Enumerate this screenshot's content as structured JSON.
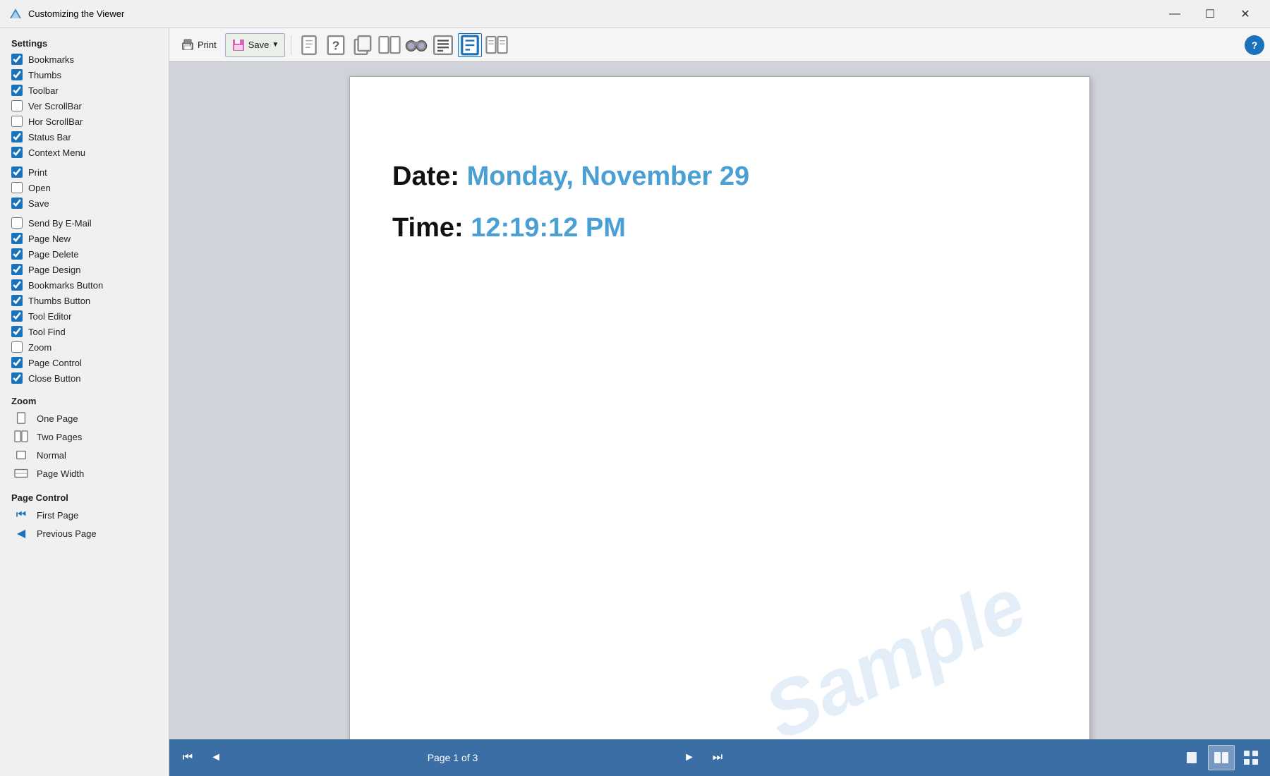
{
  "titleBar": {
    "title": "Customizing the Viewer",
    "minimize": "—",
    "maximize": "☐",
    "close": "✕"
  },
  "sidebar": {
    "settingsTitle": "Settings",
    "items": [
      {
        "id": "bookmarks",
        "label": "Bookmarks",
        "checked": true
      },
      {
        "id": "thumbs",
        "label": "Thumbs",
        "checked": true
      },
      {
        "id": "toolbar",
        "label": "Toolbar",
        "checked": true
      },
      {
        "id": "ver-scrollbar",
        "label": "Ver ScrollBar",
        "checked": false
      },
      {
        "id": "hor-scrollbar",
        "label": "Hor ScrollBar",
        "checked": false
      },
      {
        "id": "status-bar",
        "label": "Status Bar",
        "checked": true
      },
      {
        "id": "context-menu",
        "label": "Context Menu",
        "checked": true
      },
      {
        "id": "print",
        "label": "Print",
        "checked": true
      },
      {
        "id": "open",
        "label": "Open",
        "checked": false
      },
      {
        "id": "save",
        "label": "Save",
        "checked": true
      },
      {
        "id": "send-email",
        "label": "Send By E-Mail",
        "checked": false
      },
      {
        "id": "page-new",
        "label": "Page New",
        "checked": true
      },
      {
        "id": "page-delete",
        "label": "Page Delete",
        "checked": true
      },
      {
        "id": "page-design",
        "label": "Page Design",
        "checked": true
      },
      {
        "id": "bookmarks-button",
        "label": "Bookmarks Button",
        "checked": true
      },
      {
        "id": "thumbs-button",
        "label": "Thumbs Button",
        "checked": true
      },
      {
        "id": "tool-editor",
        "label": "Tool Editor",
        "checked": true
      },
      {
        "id": "tool-find",
        "label": "Tool Find",
        "checked": true
      },
      {
        "id": "zoom",
        "label": "Zoom",
        "checked": false
      },
      {
        "id": "page-control",
        "label": "Page Control",
        "checked": true
      },
      {
        "id": "close-button",
        "label": "Close Button",
        "checked": true
      }
    ],
    "zoomTitle": "Zoom",
    "zoomItems": [
      {
        "id": "one-page",
        "label": "One Page"
      },
      {
        "id": "two-pages",
        "label": "Two Pages"
      },
      {
        "id": "normal",
        "label": "Normal"
      },
      {
        "id": "page-width",
        "label": "Page Width"
      }
    ],
    "pageControlTitle": "Page Control",
    "pageControlItems": [
      {
        "id": "first-page",
        "label": "First Page"
      },
      {
        "id": "previous-page",
        "label": "Previous Page"
      }
    ]
  },
  "toolbar": {
    "printLabel": "Print",
    "saveLabel": "Save",
    "saveDropdown": true
  },
  "document": {
    "dateLine": "Date:",
    "dateValue": "Monday, November 29",
    "timeLine": "Time:",
    "timeValue": "12:19:12 PM",
    "watermark": "Sample"
  },
  "statusBar": {
    "pageInfo": "Page 1 of 3",
    "firstPage": "⏮",
    "prevPage": "◀",
    "nextPage": "▶",
    "lastPage": "⏭"
  }
}
